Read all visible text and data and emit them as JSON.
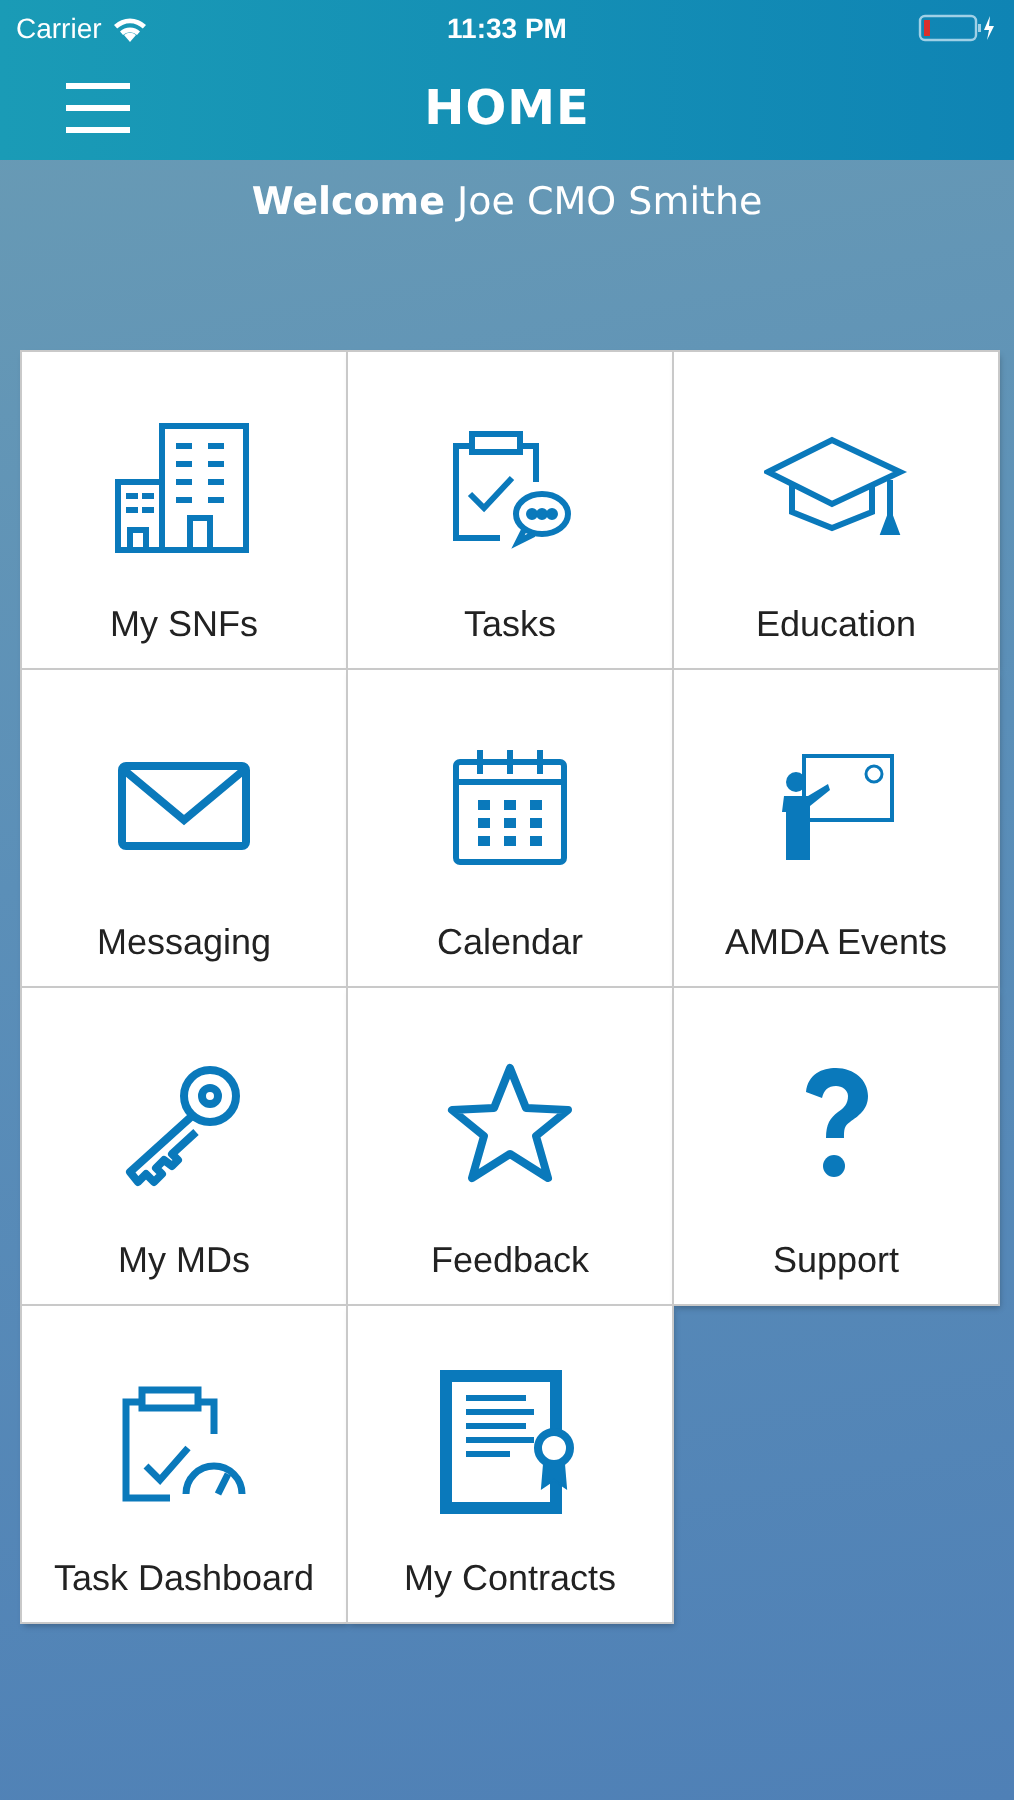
{
  "status_bar": {
    "carrier": "Carrier",
    "time": "11:33 PM"
  },
  "nav_bar": {
    "title": "HOME"
  },
  "welcome": "**Welcome** Joe CMO Smithe",
  "tiles": [
    {
      "label": "My SNFs"
    },
    {
      "label": "Tasks"
    },
    {
      "label": "Education"
    },
    {
      "label": "Messaging"
    },
    {
      "label": "Calendar"
    },
    {
      "label": "AMDA Events"
    },
    {
      "label": "My MDs"
    },
    {
      "label": "Feedback"
    },
    {
      "label": "Support"
    },
    {
      "label": "Task Dashboard"
    },
    {
      "label": "My Contracts"
    }
  ]
}
